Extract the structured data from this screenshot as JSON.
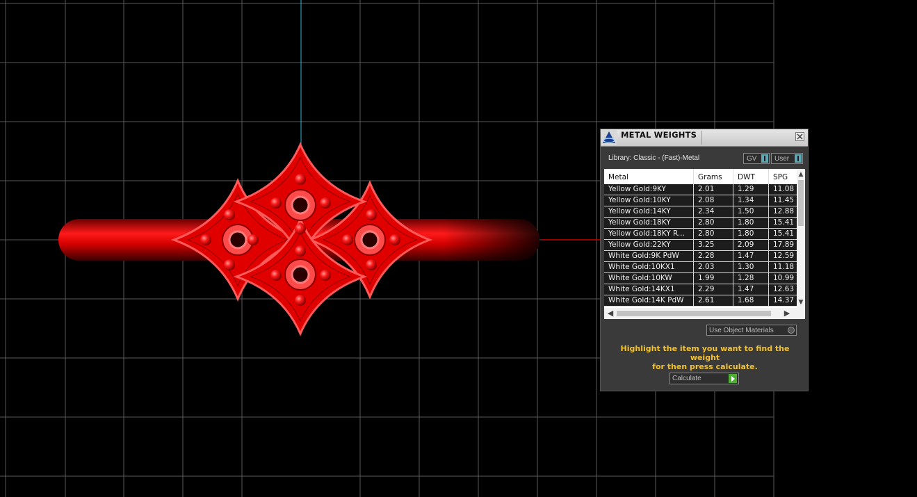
{
  "viewport": {
    "colors": {
      "background": "#000000",
      "grid": "#5a5a5a",
      "axis_vertical": "#2fb8d6",
      "axis_horizontal": "#c80000",
      "model": "#ff0000"
    }
  },
  "panel": {
    "title": "METAL WEIGHTS",
    "library_label": "Library: Classic - (Fast)-Metal",
    "toggle_gv": "GV",
    "toggle_user": "User",
    "columns": {
      "metal": "Metal",
      "grams": "Grams",
      "dwt": "DWT",
      "spg": "SPG"
    },
    "rows": [
      {
        "metal": "Yellow Gold:9KY",
        "grams": "2.01",
        "dwt": "1.29",
        "spg": "11.08"
      },
      {
        "metal": "Yellow Gold:10KY",
        "grams": "2.08",
        "dwt": "1.34",
        "spg": "11.45"
      },
      {
        "metal": "Yellow Gold:14KY",
        "grams": "2.34",
        "dwt": "1.50",
        "spg": "12.88"
      },
      {
        "metal": "Yellow Gold:18KY",
        "grams": "2.80",
        "dwt": "1.80",
        "spg": "15.41"
      },
      {
        "metal": "Yellow Gold:18KY R...",
        "grams": "2.80",
        "dwt": "1.80",
        "spg": "15.41"
      },
      {
        "metal": "Yellow Gold:22KY",
        "grams": "3.25",
        "dwt": "2.09",
        "spg": "17.89"
      },
      {
        "metal": "White Gold:9K PdW",
        "grams": "2.28",
        "dwt": "1.47",
        "spg": "12.59"
      },
      {
        "metal": "White Gold:10KX1",
        "grams": "2.03",
        "dwt": "1.30",
        "spg": "11.18"
      },
      {
        "metal": "White Gold:10KW",
        "grams": "1.99",
        "dwt": "1.28",
        "spg": "10.99"
      },
      {
        "metal": "White Gold:14KX1",
        "grams": "2.29",
        "dwt": "1.47",
        "spg": "12.63"
      },
      {
        "metal": "White Gold:14K PdW",
        "grams": "2.61",
        "dwt": "1.68",
        "spg": "14.37"
      }
    ],
    "use_object_materials": "Use Object Materials",
    "hint_line1": "Highlight the item you want to find the weight",
    "hint_line2": "for then press calculate.",
    "calculate_label": "Calculate",
    "colors": {
      "hint": "#f2c230",
      "calculate_icon": "#4caf32",
      "toggle_knob": "#5fa8b4"
    }
  }
}
